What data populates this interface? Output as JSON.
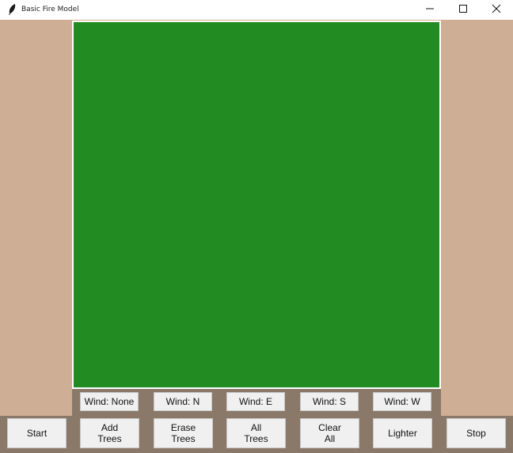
{
  "window": {
    "title": "Basic Fire Model"
  },
  "wind_buttons": [
    {
      "label": "Wind: None"
    },
    {
      "label": "Wind: N"
    },
    {
      "label": "Wind: E"
    },
    {
      "label": "Wind: S"
    },
    {
      "label": "Wind: W"
    }
  ],
  "control_buttons": [
    {
      "label": "Start"
    },
    {
      "label": "Add\nTrees"
    },
    {
      "label": "Erase\nTrees"
    },
    {
      "label": "All\nTrees"
    },
    {
      "label": "Clear\nAll"
    },
    {
      "label": "Lighter"
    },
    {
      "label": "Stop"
    }
  ],
  "colors": {
    "canvas": "#228b22",
    "side_panel": "#ceae95",
    "button_bar": "#8a7868"
  },
  "icons": [
    "feather-icon",
    "minimize-icon",
    "maximize-icon",
    "close-icon"
  ]
}
